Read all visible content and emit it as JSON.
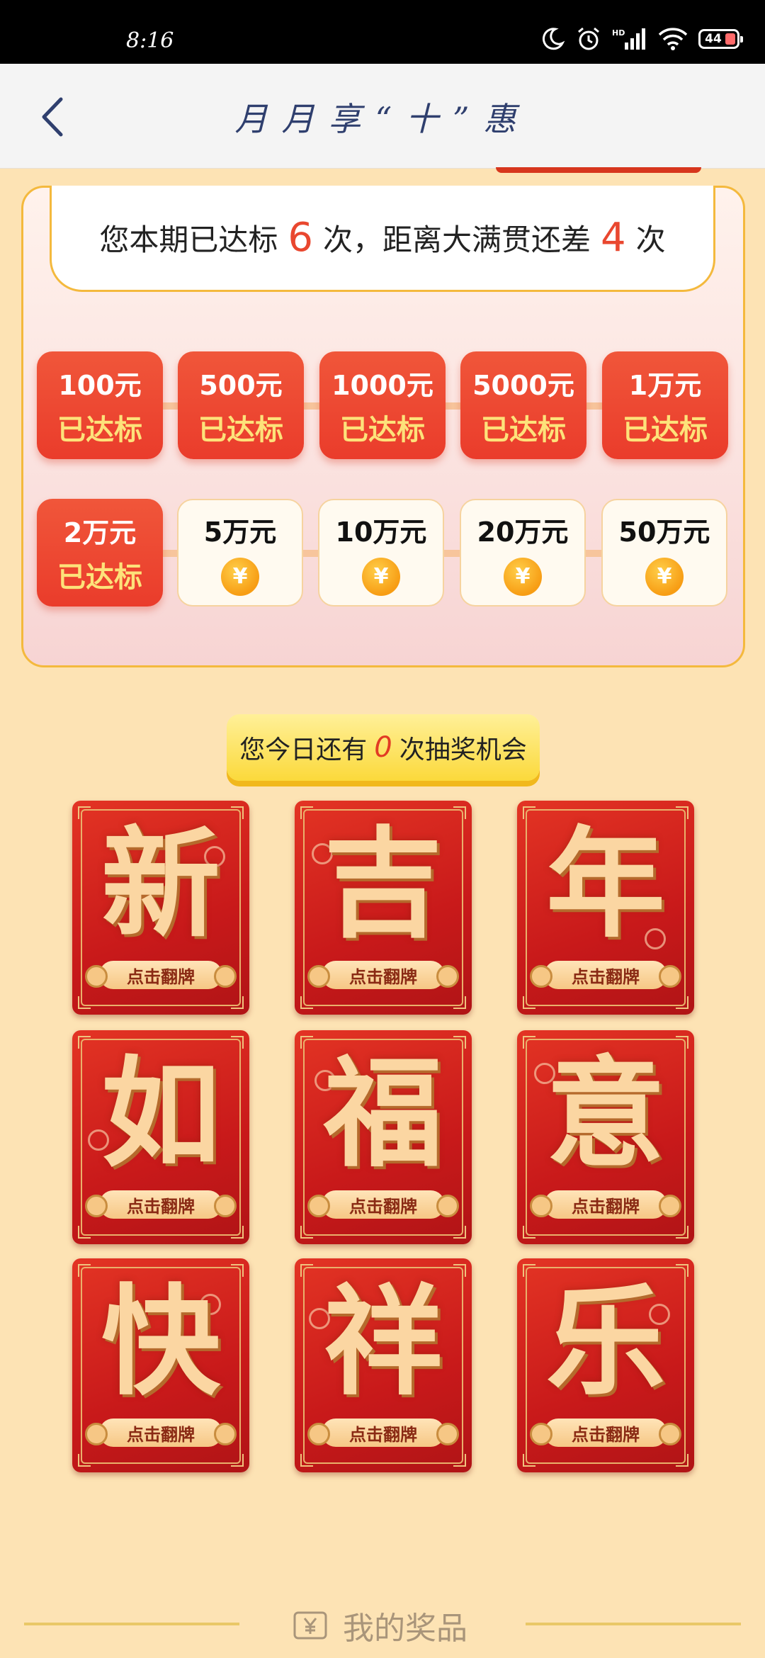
{
  "status_bar": {
    "time": "8:16",
    "battery": "44"
  },
  "nav": {
    "title": "月月享“十”惠"
  },
  "summary": {
    "prefix": "您本期已达标",
    "achieved": "6",
    "middle": "次，距离大满贯还差",
    "remaining": "4",
    "suffix": "次"
  },
  "milestones_row1": [
    {
      "amount": "100元",
      "status": "已达标"
    },
    {
      "amount": "500元",
      "status": "已达标"
    },
    {
      "amount": "1000元",
      "status": "已达标"
    },
    {
      "amount": "5000元",
      "status": "已达标"
    },
    {
      "amount": "1万元",
      "status": "已达标"
    }
  ],
  "milestones_row2": [
    {
      "amount": "2万元",
      "status": "已达标"
    },
    {
      "amount": "5万元",
      "coin": "¥"
    },
    {
      "amount": "10万元",
      "coin": "¥"
    },
    {
      "amount": "20万元",
      "coin": "¥"
    },
    {
      "amount": "50万元",
      "coin": "¥"
    }
  ],
  "chances": {
    "prefix": "您今日还有",
    "count": "0",
    "suffix": "次抽奖机会"
  },
  "cards": [
    {
      "glyph": "新",
      "button": "点击翻牌"
    },
    {
      "glyph": "吉",
      "button": "点击翻牌"
    },
    {
      "glyph": "年",
      "button": "点击翻牌"
    },
    {
      "glyph": "如",
      "button": "点击翻牌"
    },
    {
      "glyph": "福",
      "button": "点击翻牌"
    },
    {
      "glyph": "意",
      "button": "点击翻牌"
    },
    {
      "glyph": "快",
      "button": "点击翻牌"
    },
    {
      "glyph": "祥",
      "button": "点击翻牌"
    },
    {
      "glyph": "乐",
      "button": "点击翻牌"
    }
  ],
  "bottom": {
    "my_prizes": "我的奖品"
  },
  "colors": {
    "accent_red": "#ea3c2b",
    "gold": "#fde27a",
    "page_bg": "#fde3b4"
  }
}
